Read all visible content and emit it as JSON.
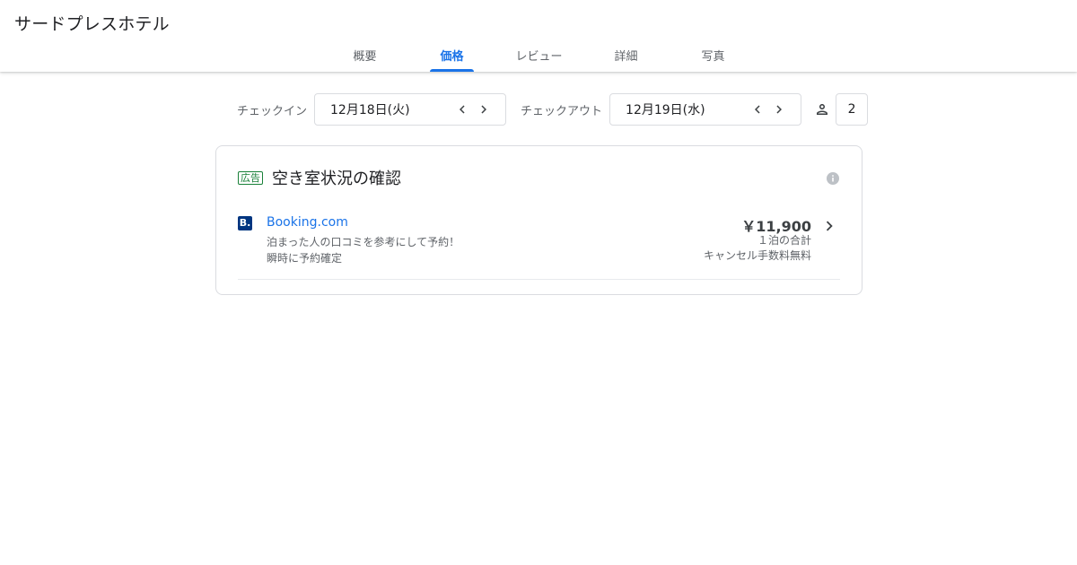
{
  "hotel": {
    "name": "サードプレスホテル"
  },
  "tabs": [
    {
      "label": "概要",
      "active": false
    },
    {
      "label": "価格",
      "active": true
    },
    {
      "label": "レビュー",
      "active": false
    },
    {
      "label": "詳細",
      "active": false
    },
    {
      "label": "写真",
      "active": false
    }
  ],
  "dates": {
    "checkin_label": "チェックイン",
    "checkin_value": "12月18日(火)",
    "checkout_label": "チェックアウト",
    "checkout_value": "12月19日(水)",
    "guests": "2"
  },
  "availability": {
    "ad_label": "広告",
    "title": "空き室状況の確認",
    "providers": [
      {
        "name": "Booking.com",
        "logo_letter": "B.",
        "desc1": "泊まった人の口コミを参考にして予約！",
        "desc2": "瞬時に予約確定",
        "price": "￥11,900",
        "price_note": "１泊の合計",
        "cancel_note": "キャンセル手数料無料"
      }
    ]
  },
  "colors": {
    "accent": "#1a73e8",
    "ad_green": "#188038",
    "booking_blue": "#003580",
    "muted_text": "#5f6368",
    "border": "#dadce0"
  },
  "icons": {
    "prev": "chevron-left-icon",
    "next": "chevron-right-icon",
    "guest": "person-icon",
    "info": "info-icon"
  }
}
